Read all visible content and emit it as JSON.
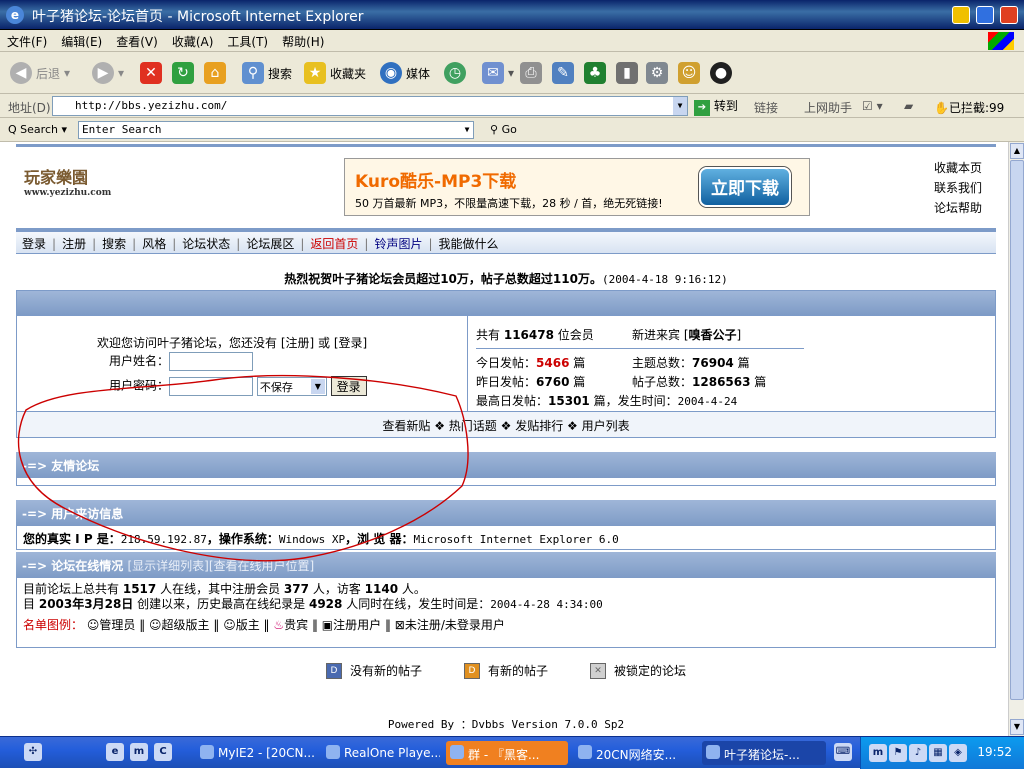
{
  "window": {
    "title": "叶子猪论坛-论坛首页 - Microsoft Internet Explorer"
  },
  "menu": [
    "文件(F)",
    "编辑(E)",
    "查看(V)",
    "收藏(A)",
    "工具(T)",
    "帮助(H)"
  ],
  "toolbar": {
    "back": "后退",
    "search": "搜索",
    "favorites": "收藏夹",
    "media": "媒体"
  },
  "address": {
    "label": "地址(D)",
    "url": "http://bbs.yezizhu.com/",
    "go": "转到",
    "links": "链接",
    "online_helper": "上网助手",
    "blocked": "已拦截:99"
  },
  "search_bar": {
    "label": "Search",
    "placeholder": "Enter Search",
    "go": "Go"
  },
  "site": {
    "logo_title": "玩家樂園",
    "logo_url": "www.yezizhu.com",
    "banner": {
      "title": "Kuro酷乐-MP3下载",
      "subtitle": "50 万首最新 MP3，不限量高速下载，28 秒 / 首，绝无死链接!",
      "button": "立即下载"
    },
    "right_links": [
      "收藏本页",
      "联系我们",
      "论坛帮助"
    ]
  },
  "nav": [
    {
      "label": "登录",
      "color": "#000000"
    },
    {
      "label": "注册",
      "color": "#000000"
    },
    {
      "label": "搜索",
      "color": "#000000"
    },
    {
      "label": "风格",
      "color": "#000000"
    },
    {
      "label": "论坛状态",
      "color": "#000000"
    },
    {
      "label": "论坛展区",
      "color": "#000000"
    },
    {
      "label": "返回首页",
      "color": "#cc0000"
    },
    {
      "label": "铃声图片",
      "color": "#000080"
    },
    {
      "label": "我能做什么",
      "color": "#000000"
    }
  ],
  "announcement": {
    "text": "热烈祝贺叶子猪论坛会员超过10万，帖子总数超过110万。",
    "date": "(2004-4-18 9:16:12)"
  },
  "login": {
    "welcome_prefix": "欢迎您访问叶子猪论坛，您还没有 [",
    "register": "注册",
    "or": "] 或 [",
    "login": "登录",
    "suffix": "]",
    "username_label": "用户姓名：",
    "password_label": "用户密码：",
    "save_option": "不保存",
    "submit": "登录"
  },
  "stats": {
    "members_prefix": "共有",
    "members": "116478",
    "members_suffix": "位会员",
    "newest_label": "新进来宾 [",
    "newest": "嗅香公子",
    "newest_suffix": "]",
    "today_label": "今日发帖：",
    "today": "5466",
    "today_unit": "篇",
    "topics_label": "主题总数：",
    "topics": "76904",
    "topics_unit": "篇",
    "yesterday_label": "昨日发帖：",
    "yesterday": "6760",
    "yesterday_unit": "篇",
    "posts_label": "帖子总数：",
    "posts": "1286563",
    "posts_unit": "篇",
    "max_label": "最高日发帖：",
    "max": "15301",
    "max_suffix": "篇，发生时间：",
    "max_date": "2004-4-24"
  },
  "quick_links": [
    "查看新贴",
    "热门话题",
    "发贴排行",
    "用户列表"
  ],
  "sections": {
    "friends": "-=> 友情论坛",
    "visitor": "-=> 用户来访信息",
    "online": "-=> 论坛在线情况",
    "online_sub": "[显示详细列表][查看在线用户位置]"
  },
  "visitor_info": {
    "ip_label": "您的真实 I P  是：",
    "ip": "218.59.192.87",
    "os_label": "，操作系统：",
    "os": "Windows XP",
    "browser_label": "，浏 览 器：",
    "browser": "Microsoft Internet Explorer 6.0"
  },
  "online_info": {
    "line1_a": "目前论坛上总共有",
    "total": "1517",
    "line1_b": "人在线，其中注册会员",
    "members": "377",
    "line1_c": "人，访客",
    "guests": "1140",
    "line1_d": "人。",
    "line2_a": "目",
    "since": "2003年3月28日",
    "line2_b": "创建以来，历史最高在线纪录是",
    "record": "4928",
    "line2_c": "人同时在线，发生时间是：",
    "record_date": "2004-4-28 4:34:00"
  },
  "legend": {
    "label": "名单图例：",
    "items": [
      "管理员",
      "超级版主",
      "版主",
      "贵宾",
      "注册用户",
      "未注册/未登录用户"
    ]
  },
  "forum_icons": [
    "没有新的帖子",
    "有新的帖子",
    "被锁定的论坛"
  ],
  "footer": "Powered By ：Dvbbs Version 7.0.0 Sp2",
  "taskbar": {
    "tasks": [
      "MyIE2 - [20CN...",
      "RealOne Playe...",
      "群 - 『黑客...",
      "20CN网络安...",
      "叶子猪论坛-..."
    ],
    "clock": "19:52"
  },
  "colors": {
    "accent": "#7d9bc8",
    "highlight": "#cc0000",
    "scribble": "#cc0000"
  }
}
